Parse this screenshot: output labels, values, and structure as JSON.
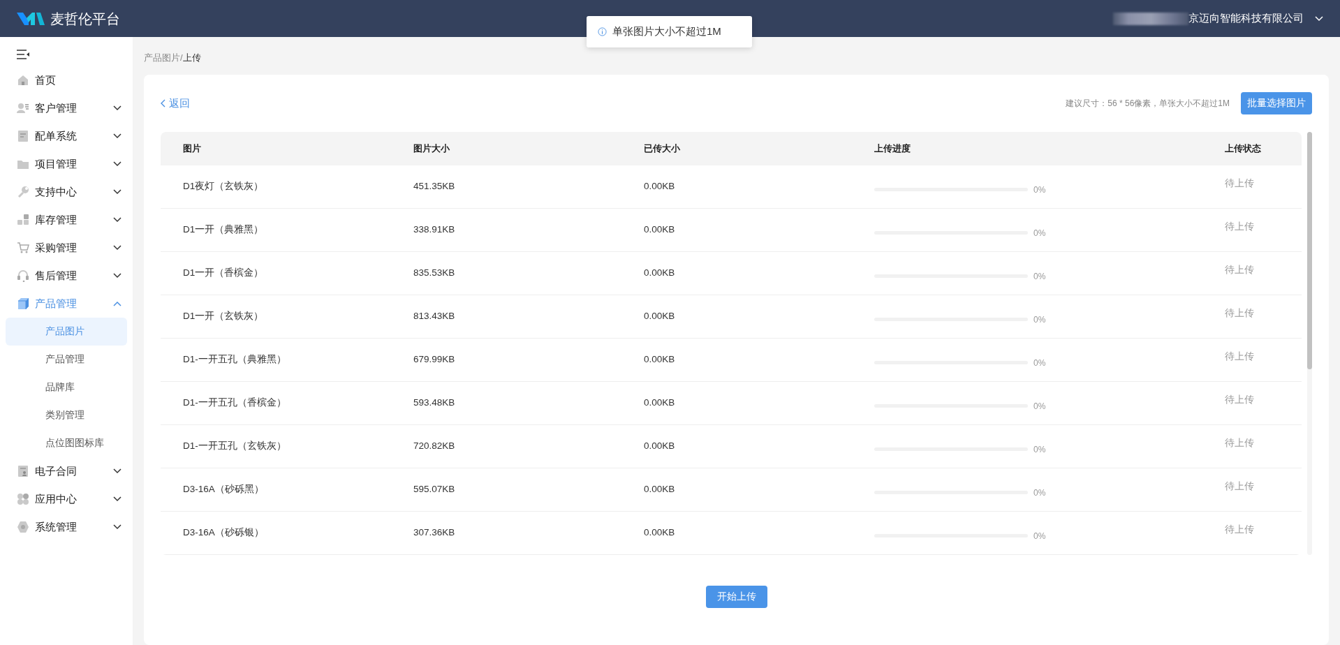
{
  "header": {
    "app_name": "麦哲伦平台",
    "account": "京迈向智能科技有限公司"
  },
  "toast": {
    "message": "单张图片大小不超过1M"
  },
  "sidebar": {
    "items": [
      {
        "kind": "link",
        "label": "首页"
      },
      {
        "kind": "group",
        "label": "客户管理",
        "expanded": false
      },
      {
        "kind": "group",
        "label": "配单系统",
        "expanded": false
      },
      {
        "kind": "group",
        "label": "项目管理",
        "expanded": false
      },
      {
        "kind": "group",
        "label": "支持中心",
        "expanded": false
      },
      {
        "kind": "group",
        "label": "库存管理",
        "expanded": false
      },
      {
        "kind": "group",
        "label": "采购管理",
        "expanded": false
      },
      {
        "kind": "group",
        "label": "售后管理",
        "expanded": false
      },
      {
        "kind": "group",
        "label": "产品管理",
        "expanded": true,
        "children": [
          {
            "label": "产品图片",
            "selected": true
          },
          {
            "label": "产品管理",
            "selected": false
          },
          {
            "label": "品牌库",
            "selected": false
          },
          {
            "label": "类别管理",
            "selected": false
          },
          {
            "label": "点位图图标库",
            "selected": false
          }
        ]
      },
      {
        "kind": "group",
        "label": "电子合同",
        "expanded": false
      },
      {
        "kind": "group",
        "label": "应用中心",
        "expanded": false
      },
      {
        "kind": "group",
        "label": "系统管理",
        "expanded": false
      }
    ]
  },
  "breadcrumb": {
    "parent": "产品图片",
    "separator": "/",
    "current": "上传"
  },
  "toolbar": {
    "back": "返回",
    "hint": "建议尺寸：56 * 56像素，单张大小不超过1M",
    "select_button": "批量选择图片"
  },
  "table": {
    "columns": [
      "图片",
      "图片大小",
      "已传大小",
      "上传进度",
      "上传状态"
    ],
    "rows": [
      {
        "name": "D1夜灯（玄铁灰）",
        "size": "451.35KB",
        "uploaded": "0.00KB",
        "level": 0,
        "percent": "0%",
        "status": "待上传"
      },
      {
        "name": "D1一开（典雅黑）",
        "size": "338.91KB",
        "uploaded": "0.00KB",
        "level": 0,
        "percent": "0%",
        "status": "待上传"
      },
      {
        "name": "D1一开（香槟金）",
        "size": "835.53KB",
        "uploaded": "0.00KB",
        "level": 0,
        "percent": "0%",
        "status": "待上传"
      },
      {
        "name": "D1一开（玄铁灰）",
        "size": "813.43KB",
        "uploaded": "0.00KB",
        "level": 0,
        "percent": "0%",
        "status": "待上传"
      },
      {
        "name": "D1-一开五孔（典雅黑）",
        "size": "679.99KB",
        "uploaded": "0.00KB",
        "level": 0,
        "percent": "0%",
        "status": "待上传"
      },
      {
        "name": "D1-一开五孔（香槟金）",
        "size": "593.48KB",
        "uploaded": "0.00KB",
        "level": 0,
        "percent": "0%",
        "status": "待上传"
      },
      {
        "name": "D1-一开五孔（玄铁灰）",
        "size": "720.82KB",
        "uploaded": "0.00KB",
        "level": 0,
        "percent": "0%",
        "status": "待上传"
      },
      {
        "name": "D3-16A（砂砾黑）",
        "size": "595.07KB",
        "uploaded": "0.00KB",
        "level": 0,
        "percent": "0%",
        "status": "待上传"
      },
      {
        "name": "D3-16A（砂砾银）",
        "size": "307.36KB",
        "uploaded": "0.00KB",
        "level": 0,
        "percent": "0%",
        "status": "待上传"
      }
    ]
  },
  "start_button": "开始上传"
}
